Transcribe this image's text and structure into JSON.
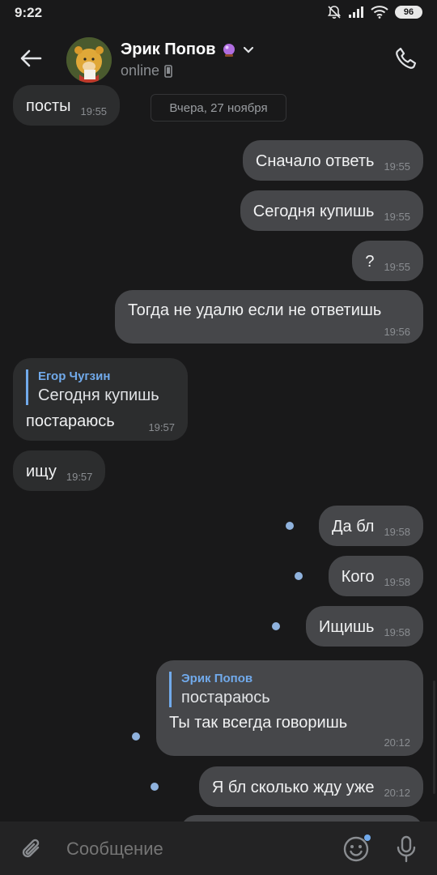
{
  "status_bar": {
    "time": "9:22",
    "battery": "96"
  },
  "header": {
    "name": "Эрик Попов",
    "status": "online",
    "back_icon": "arrow-left-icon",
    "call_icon": "phone-icon",
    "badge_icon": "crystal-ball-icon",
    "dropdown_icon": "chevron-down-icon"
  },
  "date_divider": "Вчера, 27 ноября",
  "messages": [
    {
      "dir": "in",
      "text": "посты",
      "time": "19:55"
    },
    {
      "dir": "out",
      "text": "Сначало ответь",
      "time": "19:55"
    },
    {
      "dir": "out",
      "text": "Сегодня купишь",
      "time": "19:55"
    },
    {
      "dir": "out",
      "text": "?",
      "time": "19:55"
    },
    {
      "dir": "out",
      "text": "Тогда не удалю если не ответишь",
      "time": "19:56"
    },
    {
      "dir": "in",
      "reply_author": "Егор Чугзин",
      "reply_text": "Сегодня купишь",
      "text": "постараюсь",
      "time": "19:57"
    },
    {
      "dir": "in",
      "text": "ищу",
      "time": "19:57"
    },
    {
      "dir": "out",
      "text": "Да бл",
      "time": "19:58",
      "unread": true
    },
    {
      "dir": "out",
      "text": "Кого",
      "time": "19:58",
      "unread": true
    },
    {
      "dir": "out",
      "text": "Ищишь",
      "time": "19:58",
      "unread": true
    },
    {
      "dir": "out",
      "reply_author": "Эрик Попов",
      "reply_text": "постараюсь",
      "text": "Ты так всегда говоришь",
      "time": "20:12",
      "unread": true
    },
    {
      "dir": "out",
      "text": "Я бл сколько жду уже",
      "time": "20:12",
      "unread": true
    }
  ],
  "input_bar": {
    "placeholder": "Сообщение",
    "attach_icon": "paperclip-icon",
    "emoji_icon": "smiley-icon",
    "mic_icon": "microphone-icon"
  },
  "colors": {
    "background": "#19191a",
    "incoming_bubble": "#2c2d2e",
    "outgoing_bubble": "#46474a",
    "accent": "#71aaeb",
    "unread_dot": "#8fb2dd"
  }
}
